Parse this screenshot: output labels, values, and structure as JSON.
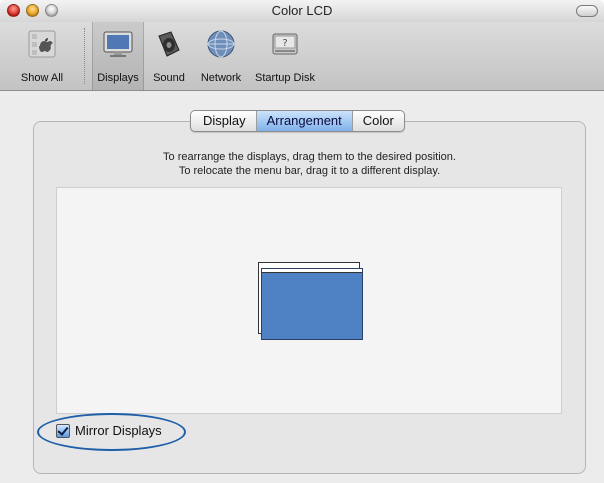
{
  "window": {
    "title": "Color LCD"
  },
  "toolbar": {
    "items": [
      {
        "label": "Show All",
        "icon": "apple-grid-icon"
      },
      {
        "label": "Displays",
        "icon": "display-icon",
        "active": true
      },
      {
        "label": "Sound",
        "icon": "speaker-icon"
      },
      {
        "label": "Network",
        "icon": "network-globe-icon"
      },
      {
        "label": "Startup Disk",
        "icon": "hard-disk-icon"
      }
    ]
  },
  "tabs": [
    {
      "label": "Display",
      "selected": false
    },
    {
      "label": "Arrangement",
      "selected": true
    },
    {
      "label": "Color",
      "selected": false
    }
  ],
  "instructions": {
    "line1": "To rearrange the displays, drag them to the desired position.",
    "line2": "To relocate the menu bar, drag it to a different display."
  },
  "mirror": {
    "label": "Mirror Displays",
    "checked": true
  },
  "colors": {
    "accent": "#4f82c4",
    "tab_selected": "#7fb1ea",
    "highlight": "#1e5fa8"
  }
}
